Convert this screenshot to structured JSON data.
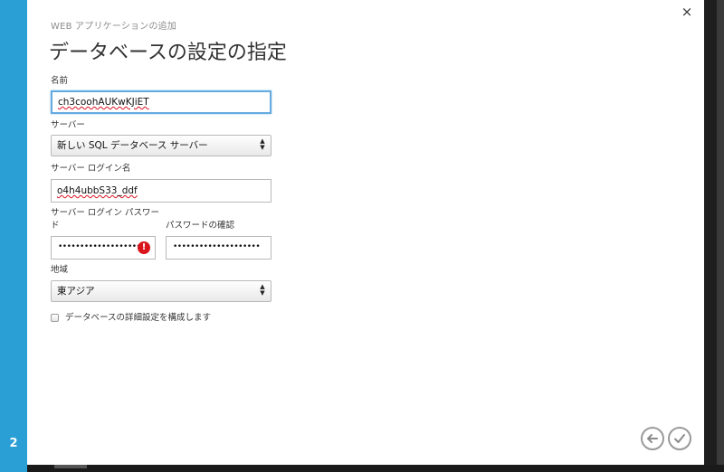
{
  "wizard": {
    "step_number": "2",
    "subtitle": "WEB アプリケーションの追加",
    "title": "データベースの設定の指定"
  },
  "form": {
    "name": {
      "label": "名前",
      "value": "ch3coohAUKwKJiET"
    },
    "server": {
      "label": "サーバー",
      "selected": "新しい SQL データベース サーバー"
    },
    "login": {
      "label": "サーバー ログイン名",
      "value": "o4h4ubbS33_ddf"
    },
    "password": {
      "label_line1": "サーバー ログイン パスワー",
      "label_line2": "ド",
      "dots": "••••••••••••••••••••",
      "error": "!"
    },
    "confirm": {
      "label": "パスワードの確認",
      "dots": "••••••••••••••••••••"
    },
    "region": {
      "label": "地域",
      "selected": "東アジア"
    },
    "advanced": {
      "label": "データベースの詳細設定を構成します",
      "checked": false
    }
  },
  "icons": {
    "close": "×",
    "select_arrows": "▲▼",
    "back": "arrow-left-icon",
    "finish": "checkmark-icon"
  },
  "colors": {
    "accent": "#2a9fd6",
    "error": "#d9141b",
    "focus": "#66aadf"
  }
}
